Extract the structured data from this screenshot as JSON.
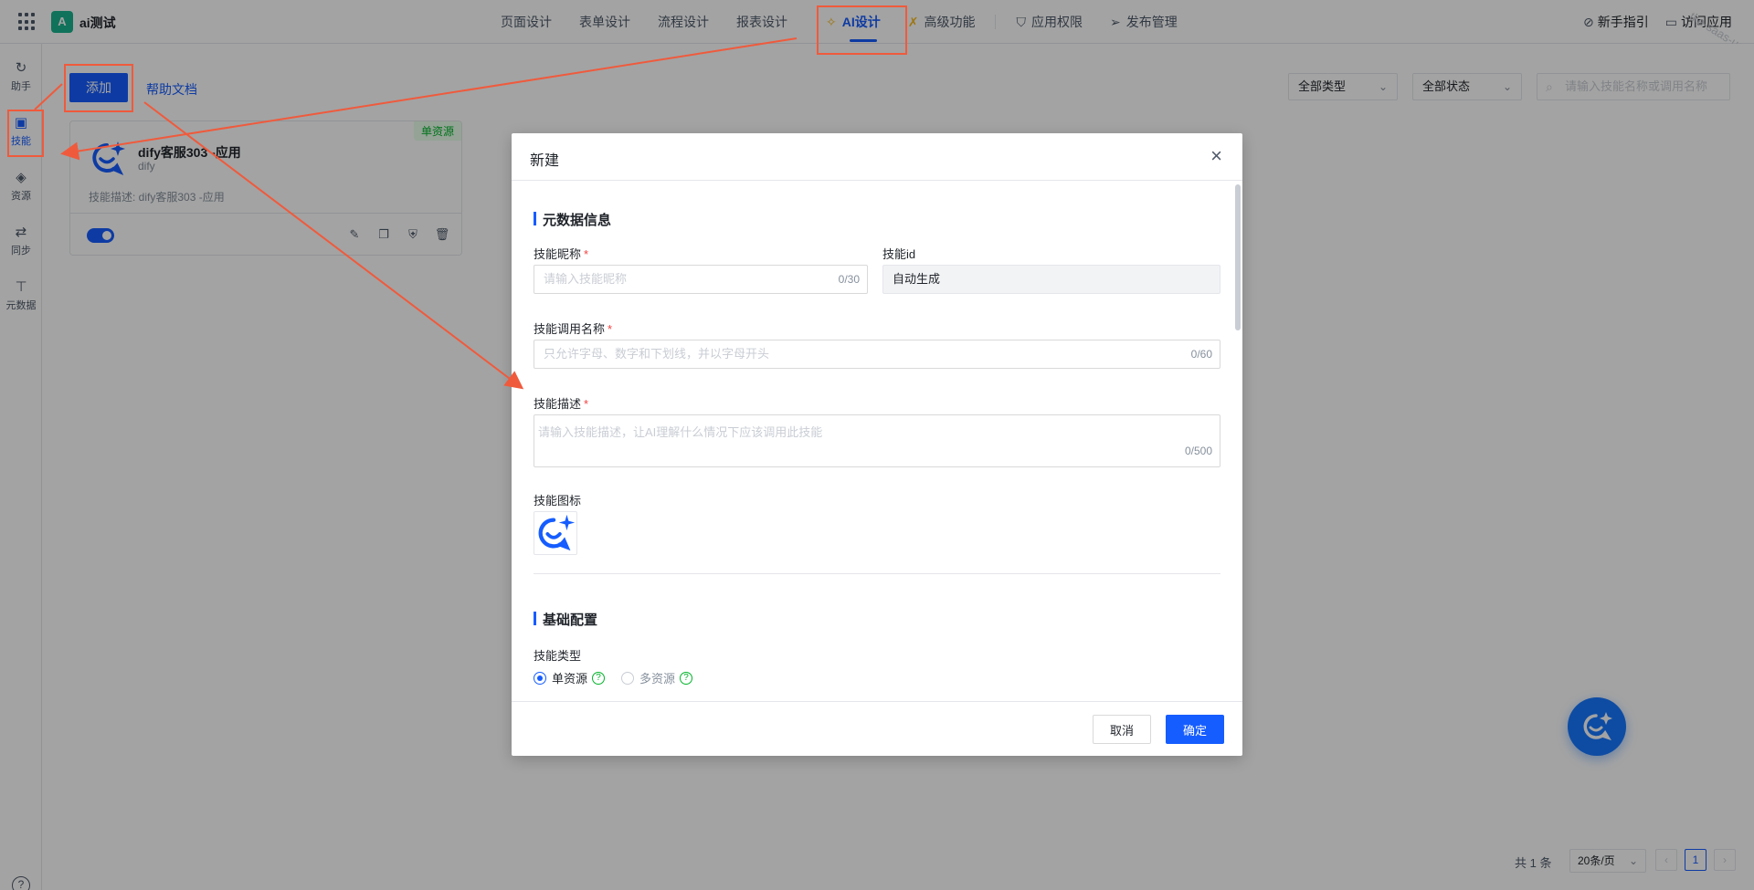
{
  "app": {
    "logo_letter": "A",
    "name": "ai测试"
  },
  "nav": {
    "items": [
      {
        "label": "页面设计"
      },
      {
        "label": "表单设计"
      },
      {
        "label": "流程设计"
      },
      {
        "label": "报表设计"
      },
      {
        "label": "AI设计"
      },
      {
        "label": "高级功能"
      },
      {
        "label": "应用权限"
      },
      {
        "label": "发布管理"
      }
    ],
    "active": "AI设计"
  },
  "top_right": {
    "guide": "新手指引",
    "visit": "访问应用"
  },
  "watermark": "tke-saas-uat",
  "sidebar": {
    "items": [
      {
        "label": "助手"
      },
      {
        "label": "技能"
      },
      {
        "label": "资源"
      },
      {
        "label": "同步"
      },
      {
        "label": "元数据"
      }
    ],
    "help": "?"
  },
  "toolbar": {
    "add_label": "添加",
    "help_doc": "帮助文档",
    "filter_type": "全部类型",
    "filter_status": "全部状态",
    "search_placeholder": "请输入技能名称或调用名称"
  },
  "card": {
    "badge": "单资源",
    "title": "dify客服303 -应用",
    "subtitle": "dify",
    "description": "技能描述: dify客服303 -应用"
  },
  "pagination": {
    "total": "共 1 条",
    "page_size": "20条/页",
    "current": "1",
    "prev": "‹",
    "next": "›"
  },
  "modal": {
    "title": "新建",
    "close": "×",
    "section_meta": "元数据信息",
    "skill_nickname_label": "技能昵称",
    "skill_nickname_placeholder": "请输入技能昵称",
    "skill_nickname_count": "0/30",
    "skill_id_label": "技能id",
    "skill_id_value": "自动生成",
    "call_name_label": "技能调用名称",
    "call_name_placeholder": "只允许字母、数字和下划线，并以字母开头",
    "call_name_count": "0/60",
    "description_label": "技能描述",
    "description_placeholder": "请输入技能描述，让AI理解什么情况下应该调用此技能",
    "description_count": "0/500",
    "icon_label": "技能图标",
    "section_basic": "基础配置",
    "skill_type_label": "技能类型",
    "type_options": [
      {
        "label": "单资源",
        "selected": true
      },
      {
        "label": "多资源",
        "selected": false
      }
    ],
    "required_mark": "*",
    "help_mark": "?",
    "cancel": "取消",
    "ok": "确定"
  },
  "colors": {
    "primary": "#165dff",
    "annotation": "#f05a3c",
    "success": "#00b42a"
  }
}
